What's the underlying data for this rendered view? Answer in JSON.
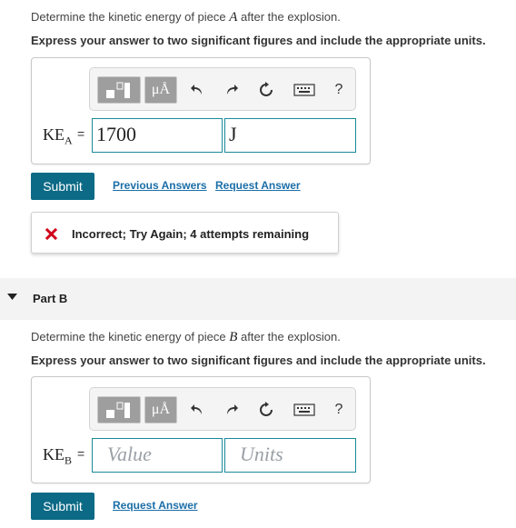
{
  "part_a": {
    "prompt_pre": "Determine the kinetic energy of piece ",
    "prompt_var": "A",
    "prompt_post": " after the explosion.",
    "instruction": "Express your answer to two significant figures and include the appropriate units.",
    "label_main": "KE",
    "label_sub": "A",
    "equals": "=",
    "value": "1700",
    "units": "J",
    "submit_label": "Submit",
    "links": [
      "Previous Answers",
      "Request Answer"
    ],
    "feedback": {
      "icon": "x-mark-icon",
      "text": "Incorrect; Try Again; 4 attempts remaining",
      "icon_color": "#d0021b"
    }
  },
  "part_b_header": {
    "toggle_icon": "triangle-down-icon",
    "title": "Part B"
  },
  "part_b": {
    "prompt_pre": "Determine the kinetic energy of piece ",
    "prompt_var": "B",
    "prompt_post": " after the explosion.",
    "instruction": "Express your answer to two significant figures and include the appropriate units.",
    "label_main": "KE",
    "label_sub": "B",
    "equals": "=",
    "value_placeholder": "Value",
    "units_placeholder": "Units",
    "submit_label": "Submit",
    "links": [
      "Request Answer"
    ]
  },
  "toolbar": {
    "units_button_label": "μÅ",
    "help_label": "?",
    "icons": [
      "templates-icon",
      "units-icon",
      "undo-icon",
      "redo-icon",
      "reset-icon",
      "keyboard-icon",
      "help-icon"
    ]
  },
  "colors": {
    "accent": "#0c6a86",
    "link": "#1b6ea8",
    "field_border": "#1a8a9a",
    "error": "#d0021b"
  }
}
